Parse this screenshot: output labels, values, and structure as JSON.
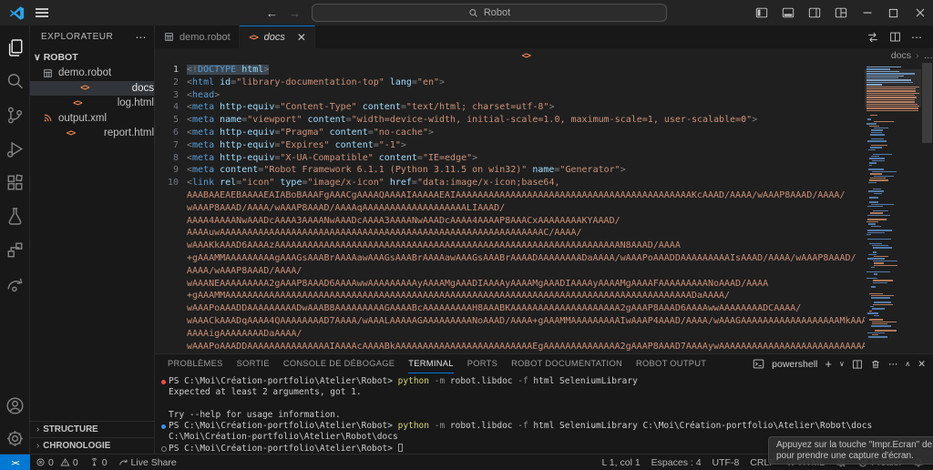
{
  "titlebar": {
    "search_value": "Robot"
  },
  "sidebar": {
    "title": "EXPLORATEUR",
    "root": "ROBOT",
    "files": [
      {
        "name": "demo.robot",
        "icon": "grid",
        "selected": false
      },
      {
        "name": "docs",
        "icon": "code",
        "selected": true
      },
      {
        "name": "log.html",
        "icon": "code",
        "selected": false
      },
      {
        "name": "output.xml",
        "icon": "rss",
        "selected": false
      },
      {
        "name": "report.html",
        "icon": "code",
        "selected": false
      }
    ],
    "sections": [
      "STRUCTURE",
      "CHRONOLOGIE"
    ]
  },
  "editor": {
    "tabs": [
      {
        "label": "demo.robot"
      },
      {
        "label": "docs"
      }
    ],
    "breadcrumb": {
      "file": "docs",
      "more": "…"
    },
    "code_lines": [
      {
        "num": "1",
        "sel": true,
        "tokens": [
          [
            "p",
            "<!"
          ],
          [
            "t",
            "DOCTYPE"
          ],
          [
            "a",
            " html"
          ],
          [
            "p",
            ">"
          ]
        ]
      },
      {
        "num": "2",
        "tokens": [
          [
            "p",
            "<"
          ],
          [
            "t",
            "html"
          ],
          [
            "a",
            " id"
          ],
          [
            "p",
            "="
          ],
          [
            "s",
            "\"library-documentation-top\""
          ],
          [
            "a",
            " lang"
          ],
          [
            "p",
            "="
          ],
          [
            "s",
            "\"en\""
          ],
          [
            "p",
            ">"
          ]
        ]
      },
      {
        "num": "3",
        "tokens": [
          [
            "p",
            "<"
          ],
          [
            "t",
            "head"
          ],
          [
            "p",
            ">"
          ]
        ]
      },
      {
        "num": "4",
        "tokens": [
          [
            "p",
            "<"
          ],
          [
            "t",
            "meta"
          ],
          [
            "a",
            " http-equiv"
          ],
          [
            "p",
            "="
          ],
          [
            "s",
            "\"Content-Type\""
          ],
          [
            "a",
            " content"
          ],
          [
            "p",
            "="
          ],
          [
            "s",
            "\"text/html; charset=utf-8\""
          ],
          [
            "p",
            ">"
          ]
        ]
      },
      {
        "num": "5",
        "tokens": [
          [
            "p",
            "<"
          ],
          [
            "t",
            "meta"
          ],
          [
            "a",
            " name"
          ],
          [
            "p",
            "="
          ],
          [
            "s",
            "\"viewport\""
          ],
          [
            "a",
            " content"
          ],
          [
            "p",
            "="
          ],
          [
            "s",
            "\"width=device-width, initial-scale=1.0, maximum-scale=1, user-scalable=0\""
          ],
          [
            "p",
            ">"
          ]
        ]
      },
      {
        "num": "6",
        "tokens": [
          [
            "p",
            "<"
          ],
          [
            "t",
            "meta"
          ],
          [
            "a",
            " http-equiv"
          ],
          [
            "p",
            "="
          ],
          [
            "s",
            "\"Pragma\""
          ],
          [
            "a",
            " content"
          ],
          [
            "p",
            "="
          ],
          [
            "s",
            "\"no-cache\""
          ],
          [
            "p",
            ">"
          ]
        ]
      },
      {
        "num": "7",
        "tokens": [
          [
            "p",
            "<"
          ],
          [
            "t",
            "meta"
          ],
          [
            "a",
            " http-equiv"
          ],
          [
            "p",
            "="
          ],
          [
            "s",
            "\"Expires\""
          ],
          [
            "a",
            " content"
          ],
          [
            "p",
            "="
          ],
          [
            "s",
            "\"-1\""
          ],
          [
            "p",
            ">"
          ]
        ]
      },
      {
        "num": "8",
        "tokens": [
          [
            "p",
            "<"
          ],
          [
            "t",
            "meta"
          ],
          [
            "a",
            " http-equiv"
          ],
          [
            "p",
            "="
          ],
          [
            "s",
            "\"X-UA-Compatible\""
          ],
          [
            "a",
            " content"
          ],
          [
            "p",
            "="
          ],
          [
            "s",
            "\"IE=edge\""
          ],
          [
            "p",
            ">"
          ]
        ]
      },
      {
        "num": "9",
        "tokens": [
          [
            "p",
            "<"
          ],
          [
            "t",
            "meta"
          ],
          [
            "a",
            " content"
          ],
          [
            "p",
            "="
          ],
          [
            "s",
            "\"Robot Framework 6.1.1 (Python 3.11.5 on win32)\""
          ],
          [
            "a",
            " name"
          ],
          [
            "p",
            "="
          ],
          [
            "s",
            "\"Generator\""
          ],
          [
            "p",
            ">"
          ]
        ]
      },
      {
        "num": "10",
        "tokens": [
          [
            "p",
            "<"
          ],
          [
            "t",
            "link"
          ],
          [
            "a",
            " rel"
          ],
          [
            "p",
            "="
          ],
          [
            "s",
            "\"icon\""
          ],
          [
            "a",
            " type"
          ],
          [
            "p",
            "="
          ],
          [
            "s",
            "\"image/x-icon\""
          ],
          [
            "a",
            " href"
          ],
          [
            "p",
            "="
          ],
          [
            "s",
            "\"data:image/x-icon;base64,"
          ]
        ]
      }
    ],
    "wrap_lines": [
      "AAABAAEAEBAAAAEAIABoBAAAFgAAACgAAAAQAAAAIAAAAAEAIAAAAAAAAAAAAAAAAAAAAAAAAAAAAAAAAAAAAAAAAAAAKcAAAD/AAAA/wAAAP8AAAD/AAAA/",
      "wAAAP8AAAD/AAAA/wAAAP8AAAD/AAAAqAAAAAAAAAAAAAAAAAAALIAAAD/",
      "AAAA4AAAANwAAADcAAAA3AAAANwAAADcAAAA3AAAANwAAADcAAAA4AAAAP8AAACxAAAAAAAAKYAAAD/",
      "AAAAuwAAAAAAAAAAAAAAAAAAAAAAAAAAAAAAAAAAAAAAAAAAAAAAAAAAAAAAAAAAAC/AAAA/",
      "wAAAKkAAAD6AAAAzAAAAAAAAAAAAAAAAAAAAAAAAAAAAAAAAAAAAAAAAAAAAAAAAAAAAAAAAAAAAAAAN8AAAD/AAAA",
      "+gAAAMMAAAAAAAAAgAAAGsAAABrAAAAawAAAGsAAABrAAAAawAAAGsAAABrAAAADAAAAAAAADaAAAA/wAAAPoAAADDAAAAAAAAAIsAAAD/AAAA/wAAAP8AAAD/",
      "AAAA/wAAAP8AAAD/AAAA/",
      "wAAANEAAAAAAAAA2gAAAP8AAAD6AAAAwwAAAAAAAAAyAAAAMgAAADIAAAAyAAAAMgAAADIAAAAyAAAAMgAAAAFAAAAAAAAANoAAAD/AAAA",
      "+gAAAMMAAAAAAAAAAAAAAAAAAAAAAAAAAAAAAAAAAAAAAAAAAAAAAAAAAAAAAAAAAAAAAAAAAAAAAAAAAAAAAAAAAAAADaAAAA/",
      "wAAAPoAAADDAAAAAAAAADwAAAB8AAAAAAAAAGAAAABcAAAAAAAAAH8AAABKAAAAAAAAAAAAAAAAAAAA2gAAAP8AAAD6AAAAwwAAAAAAAADCAAAA/",
      "wAAACkAAADqAAAA4QAAAAAAAAD7AAAA/wAAALAAAAAGAAAAAAAAANoAAAD/AAAA+gAAAMMAAAAAAAAAIwAAAP4AAAD/AAAA/wAAAGAAAAAAAAAAAAAAAAAAMkAAAD/",
      "AAAAigAAAAAAAADaAAAA/",
      "wAAAPoAAADDAAAAAAAAAAAAAAAIAAAAcAAAABkAAAAAAAAAAAAAAAAAAAAAAAAAEgAAAAAAAAAAAAAA2gAAAP8AAAD7AAAAywAAAAAAAAAAAAAAAAAAAAAAAAAAAAAAAAAAAAAA"
    ]
  },
  "panel": {
    "tabs": [
      {
        "label": "PROBLÈMES",
        "active": false
      },
      {
        "label": "SORTIE",
        "active": false
      },
      {
        "label": "CONSOLE DE DÉBOGAGE",
        "active": false
      },
      {
        "label": "TERMINAL",
        "active": true
      },
      {
        "label": "PORTS",
        "active": false
      },
      {
        "label": "ROBOT DOCUMENTATION",
        "active": false
      },
      {
        "label": "ROBOT OUTPUT",
        "active": false
      }
    ],
    "terminal": {
      "shell_label": "powershell",
      "lines": [
        {
          "dot": "red",
          "tokens": [
            [
              "d",
              "PS C:\\Moi\\Création-portfolio\\Atelier\\Robot> "
            ],
            [
              "y",
              "python"
            ],
            [
              "f",
              " -m"
            ],
            [
              "d",
              " robot.libdoc"
            ],
            [
              "f",
              " -f"
            ],
            [
              "d",
              " html SeleniumLibrary"
            ]
          ]
        },
        {
          "dot": "none",
          "tokens": [
            [
              "d",
              "Expected at least 2 arguments, got 1."
            ]
          ]
        },
        {
          "dot": "none",
          "tokens": []
        },
        {
          "dot": "none",
          "tokens": [
            [
              "d",
              "Try --help for usage information."
            ]
          ]
        },
        {
          "dot": "blue",
          "tokens": [
            [
              "d",
              "PS C:\\Moi\\Création-portfolio\\Atelier\\Robot> "
            ],
            [
              "y",
              "python"
            ],
            [
              "f",
              " -m"
            ],
            [
              "d",
              " robot.libdoc"
            ],
            [
              "f",
              " -f"
            ],
            [
              "d",
              " html SeleniumLibrary C:\\Moi\\Création-portfolio\\Atelier\\Robot\\docs"
            ]
          ]
        },
        {
          "dot": "none",
          "tokens": [
            [
              "d",
              "C:\\Moi\\Création-portfolio\\Atelier\\Robot\\docs"
            ]
          ]
        },
        {
          "dot": "hollow",
          "tokens": [
            [
              "d",
              "PS C:\\Moi\\Création-portfolio\\Atelier\\Robot> "
            ],
            [
              "cur",
              ""
            ]
          ]
        }
      ]
    }
  },
  "status_bar": {
    "left": {
      "errors": "0",
      "warnings": "0",
      "ports": "0",
      "liveshare": "Live Share"
    },
    "right": [
      {
        "name": "line-col",
        "label": "L 1, col 1"
      },
      {
        "name": "indentation",
        "label": "Espaces : 4"
      },
      {
        "name": "encoding",
        "label": "UTF-8"
      },
      {
        "name": "eol",
        "label": "CRLF"
      },
      {
        "name": "language-mode",
        "label": "HTML",
        "icon": "braces"
      },
      {
        "name": "bell-muted",
        "label": "",
        "icon": "bellslash"
      },
      {
        "name": "prettier",
        "label": "Prettier",
        "icon": "slashcircle"
      },
      {
        "name": "notifications",
        "label": "",
        "icon": "bell"
      }
    ]
  },
  "toast": {
    "line1": "Appuyez sur la touche \"Impr.Ecran\" de votre clavier",
    "line2": "pour prendre une capture d'écran."
  }
}
